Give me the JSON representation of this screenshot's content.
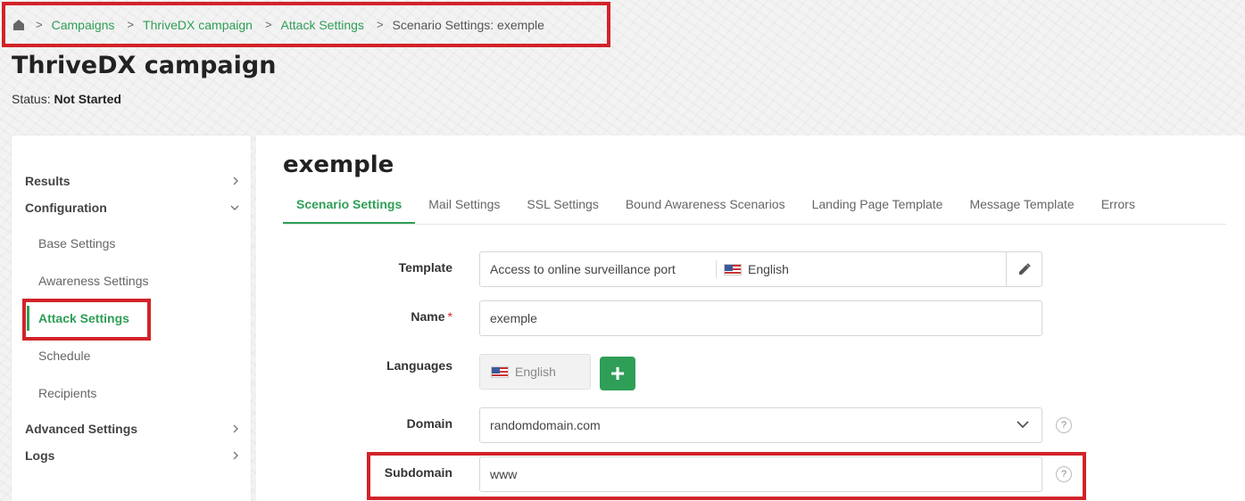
{
  "breadcrumb": {
    "items": [
      "Campaigns",
      "ThriveDX campaign",
      "Attack Settings"
    ],
    "current": "Scenario Settings: exemple",
    "separator": ">"
  },
  "page": {
    "title": "ThriveDX campaign",
    "status_label": "Status:",
    "status_value": "Not Started"
  },
  "sidebar": {
    "results": "Results",
    "configuration": "Configuration",
    "base_settings": "Base Settings",
    "awareness_settings": "Awareness Settings",
    "attack_settings": "Attack Settings",
    "schedule": "Schedule",
    "recipients": "Recipients",
    "advanced_settings": "Advanced Settings",
    "logs": "Logs"
  },
  "main": {
    "scenario_title": "exemple",
    "tabs": [
      {
        "label": "Scenario Settings",
        "active": true
      },
      {
        "label": "Mail Settings"
      },
      {
        "label": "SSL Settings"
      },
      {
        "label": "Bound Awareness Scenarios"
      },
      {
        "label": "Landing Page Template"
      },
      {
        "label": "Message Template"
      },
      {
        "label": "Errors"
      }
    ],
    "form": {
      "template_label": "Template",
      "template_value": "Access to online surveillance port",
      "template_language": "English",
      "name_label": "Name",
      "name_required": "*",
      "name_value": "exemple",
      "languages_label": "Languages",
      "language_chip": "English",
      "add_symbol": "+",
      "domain_label": "Domain",
      "domain_value": "randomdomain.com",
      "subdomain_label": "Subdomain",
      "subdomain_value": "www",
      "help_symbol": "?"
    }
  },
  "colors": {
    "accent": "#2f9e57",
    "highlight": "#d2232a"
  }
}
